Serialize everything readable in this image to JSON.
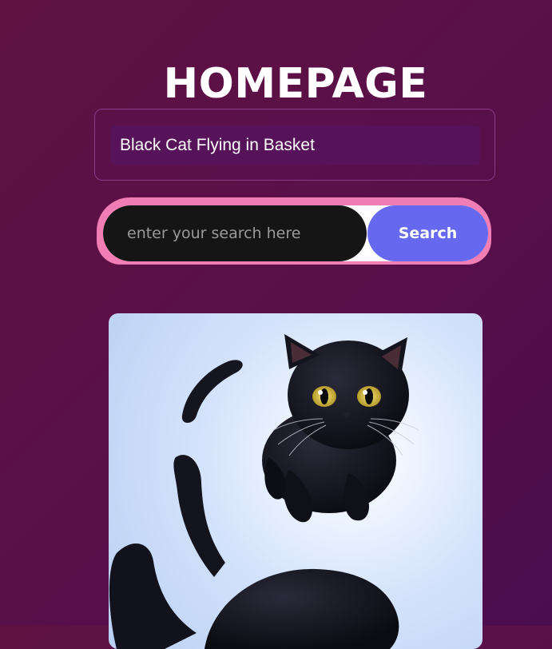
{
  "page": {
    "title": "HOMEPAGE"
  },
  "query": {
    "text": "Black Cat Flying in Basket"
  },
  "search": {
    "placeholder": "enter your search here",
    "value": "",
    "button_label": "Search"
  },
  "result": {
    "image": "generated-image"
  },
  "colors": {
    "background": "#5a1048",
    "search_button": "#6668ef",
    "search_accent": "#f07db4",
    "search_input": "#151515"
  }
}
